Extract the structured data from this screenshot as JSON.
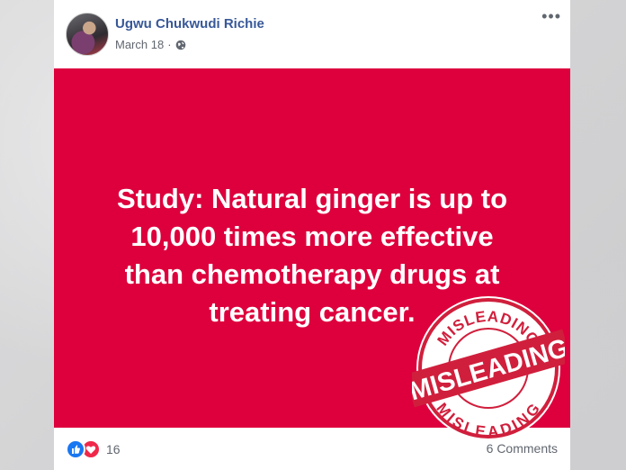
{
  "post": {
    "author": "Ugwu Chukwudi Richie",
    "date": "March 18",
    "date_separator": "·",
    "privacy_icon": "globe-icon",
    "menu_label": "•••",
    "headline_lines": [
      "Study: Natural ginger is up to",
      "10,000 times more effective",
      "than chemotherapy drugs at",
      "treating cancer."
    ],
    "panel_color": "#dd003d",
    "stamp": {
      "top_text": "MISLEADING",
      "center_text": "MISLEADING",
      "bottom_text": "MISLEADING",
      "color": "#d01f3c"
    },
    "reaction_icons": [
      "like-icon",
      "love-icon"
    ],
    "reaction_count": "16",
    "comments": "6 Comments"
  }
}
